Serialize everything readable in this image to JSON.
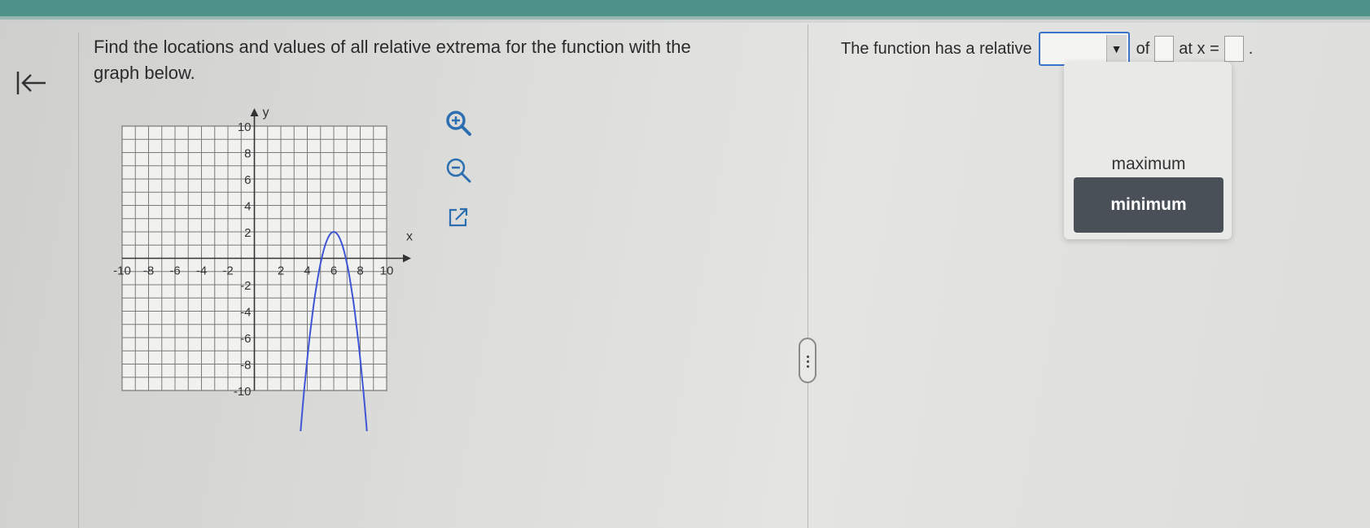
{
  "question": {
    "text": "Find the locations and values of all relative extrema for the function with the graph below."
  },
  "graph": {
    "x_axis_label": "x",
    "y_axis_label": "y",
    "x_tick_labels": [
      "-10",
      "-8",
      "-6",
      "-4",
      "-2",
      "2",
      "4",
      "6",
      "8",
      "10"
    ],
    "y_tick_labels": [
      "10",
      "8",
      "6",
      "4",
      "2",
      "-2",
      "-4",
      "-6",
      "-8",
      "-10"
    ],
    "curve_color": "#3f55d6"
  },
  "tools": {
    "zoom_in": "zoom-in-icon",
    "zoom_out": "zoom-out-icon",
    "popout": "external-link-icon"
  },
  "answer": {
    "prefix": "The function has a relative",
    "dropdown_value": "",
    "of_label": "of",
    "at_label": "at x =",
    "value_box": "",
    "x_box": "",
    "end": "."
  },
  "dropdown_menu": {
    "options": [
      "maximum",
      "minimum"
    ],
    "highlighted": "minimum"
  },
  "colors": {
    "topbar": "#4e9189",
    "focus_border": "#3a74c9",
    "highlight": "#4a5058"
  }
}
